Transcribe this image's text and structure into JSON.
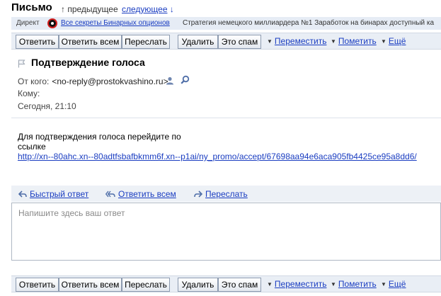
{
  "header": {
    "title": "Письмо",
    "prev_arrow": "↑",
    "prev_label": "предыдущее",
    "next_label": "следующее",
    "next_arrow": "↓"
  },
  "direct": {
    "label": "Директ",
    "link_text": "Все секреты Бинарных опционов",
    "ad_text": "Стратегия немецкого миллиардера №1 Заработок на бинарах доступный ка"
  },
  "toolbar": {
    "reply": "Ответить",
    "reply_all": "Ответить всем",
    "forward": "Переслать",
    "delete": "Удалить",
    "spam": "Это спам",
    "move": "Переместить",
    "mark": "Пометить",
    "more": "Ещё",
    "caret": "▼"
  },
  "message": {
    "subject": "Подтверждение голоса",
    "from_label": "От кого:",
    "from_value": "<no-reply@prostokvashino.ru>",
    "to_label": "Кому:",
    "date": "Сегодня, 21:10",
    "body_text": "Для подтверждения голоса перейдите по ссылке",
    "body_link": "http://xn--80ahc.xn--80adtfsbafbkmm6f.xn--p1ai/ny_promo/accept/67698aa94e6aca905fb4425ce95a8dd6/"
  },
  "quick_reply": {
    "quick": "Быстрый ответ",
    "reply_all": "Ответить всем",
    "forward": "Переслать",
    "placeholder": "Напишите здесь ваш ответ"
  },
  "colors": {
    "link": "#1a3dc1",
    "toolbar_bg": "#e9eef5",
    "direct_bg": "#e6ecf5",
    "button_border": "#8d9bb0"
  }
}
